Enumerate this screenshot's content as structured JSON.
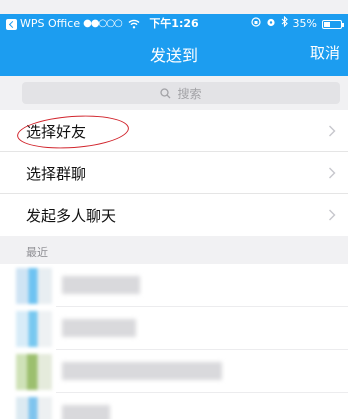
{
  "status_bar": {
    "app_name": "WPS Office",
    "signal": "●●○○○",
    "time": "下午1:26",
    "battery": "35%",
    "battery_level": 0.35
  },
  "navbar": {
    "title": "发送到",
    "cancel_label": "取消"
  },
  "search": {
    "placeholder": "搜索"
  },
  "menu": {
    "items": [
      {
        "label": "选择好友"
      },
      {
        "label": "选择群聊"
      },
      {
        "label": "发起多人聊天"
      }
    ]
  },
  "recent": {
    "header": "最近"
  },
  "colors": {
    "accent": "#1c9df0",
    "highlight_ring": "#d1242c",
    "page_bg": "#f1f1f3"
  }
}
